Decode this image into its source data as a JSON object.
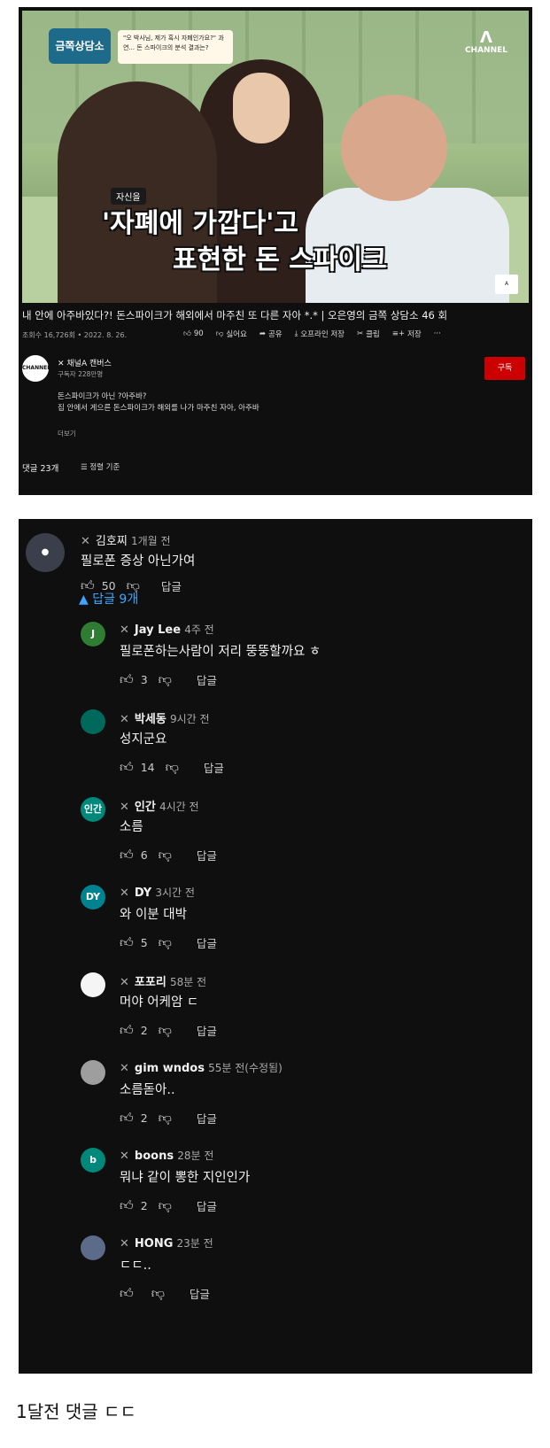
{
  "video": {
    "show_logo": "금쪽상담소",
    "quote_bubble": "\"오 박사님, 제가 혹시 자폐인가요?\" 과연... 돈 스파이크의 분석 결과는?",
    "channel_watermark": "CHANNEL",
    "caption_tag": "자신을",
    "caption_line1": "'자폐에 가깝다'고",
    "caption_line2": "표현한 돈 스파이크",
    "title": "내 안에 아주바있다?! 돈스파이크가 해외에서 마주친 또 다른 자아 *.* | 오은영의 금쪽 상담소 46 회",
    "views_date": "조회수 16,726회 • 2022. 8. 26.",
    "likes": "90",
    "dislike_label": "싫어요",
    "share_label": "공유",
    "offline_label": "오프라인 저장",
    "clip_label": "클립",
    "save_label": "저장",
    "more_label": "···"
  },
  "channel": {
    "avatar_text": "CHANNEL",
    "name": "✕ 채널A 캔버스",
    "subs": "구독자 228만명",
    "subscribe_label": "구독",
    "desc1": "돈스파이크가 아닌 ?아주바?",
    "desc2": "집 안에서 게으른 돈스파이크가 해외를 나가 마주친 자아, 아주바",
    "more_label": "더보기"
  },
  "comments_header": {
    "count": "댓글 23개",
    "sort_label": "정렬 기준"
  },
  "top_comment": {
    "author": "김호찌",
    "time": "1개월 전",
    "text": "필로폰 증상 아닌가여",
    "likes": "50",
    "reply_label": "답글",
    "replies_toggle": "▲  답글 9개"
  },
  "replies": [
    {
      "avatar": "J",
      "color": "#2e7d32",
      "author": "Jay Lee",
      "time": "4주 전",
      "text": "필로폰하는사람이 저리 뚱뚱할까요 ㅎ",
      "likes": "3",
      "reply_label": "답글"
    },
    {
      "avatar": "",
      "color": "#00695c",
      "author": "박세동",
      "time": "9시간 전",
      "text": "성지군요",
      "likes": "14",
      "reply_label": "답글"
    },
    {
      "avatar": "인간",
      "color": "#00897b",
      "author": "인간",
      "time": "4시간 전",
      "text": "소름",
      "likes": "6",
      "reply_label": "답글"
    },
    {
      "avatar": "DY",
      "color": "#00838f",
      "author": "DY",
      "time": "3시간 전",
      "text": "와 이분 대박",
      "likes": "5",
      "reply_label": "답글"
    },
    {
      "avatar": "",
      "color": "#f5f5f5",
      "author": "포포리",
      "time": "58분 전",
      "text": "머야 어케암 ㄷ",
      "likes": "2",
      "reply_label": "답글"
    },
    {
      "avatar": "",
      "color": "#9e9e9e",
      "author": "gim wndos",
      "time": "55분 전(수정됨)",
      "text": "소름돋아..",
      "likes": "2",
      "reply_label": "답글"
    },
    {
      "avatar": "b",
      "color": "#00897b",
      "author": "boons",
      "time": "28분 전",
      "text": "뭐냐 같이 뽕한 지인인가",
      "likes": "2",
      "reply_label": "답글"
    },
    {
      "avatar": "",
      "color": "#5d6b8a",
      "author": "HONG",
      "time": "23분 전",
      "text": "ㄷㄷ..",
      "likes": "",
      "reply_label": "답글"
    }
  ],
  "footer_note": "1달전 댓글 ㄷㄷ"
}
